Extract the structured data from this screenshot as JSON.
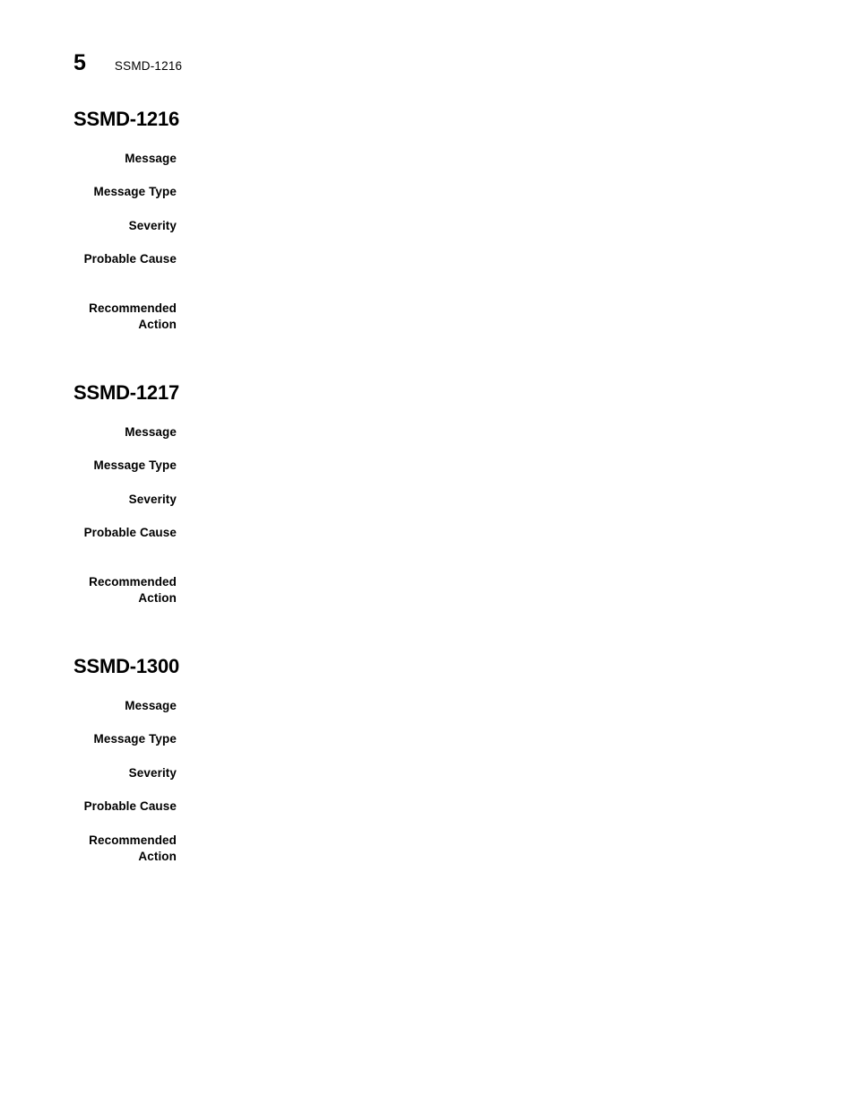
{
  "header": {
    "chapter_number": "5",
    "title": "SSMD-1216"
  },
  "labels": {
    "message": "Message",
    "message_type": "Message Type",
    "severity": "Severity",
    "probable_cause": "Probable Cause",
    "recommended_action": "Recommended\nAction"
  },
  "sections": [
    {
      "heading": "SSMD-1216",
      "fields": [
        {
          "label": "Message",
          "value": ""
        },
        {
          "label": "Message Type",
          "value": ""
        },
        {
          "label": "Severity",
          "value": ""
        },
        {
          "label": "Probable Cause",
          "value": ""
        },
        {
          "label": "Recommended\nAction",
          "value": ""
        }
      ]
    },
    {
      "heading": "SSMD-1217",
      "fields": [
        {
          "label": "Message",
          "value": ""
        },
        {
          "label": "Message Type",
          "value": ""
        },
        {
          "label": "Severity",
          "value": ""
        },
        {
          "label": "Probable Cause",
          "value": ""
        },
        {
          "label": "Recommended\nAction",
          "value": ""
        }
      ]
    },
    {
      "heading": "SSMD-1300",
      "fields": [
        {
          "label": "Message",
          "value": ""
        },
        {
          "label": "Message Type",
          "value": ""
        },
        {
          "label": "Severity",
          "value": ""
        },
        {
          "label": "Probable Cause",
          "value": ""
        },
        {
          "label": "Recommended\nAction",
          "value": ""
        }
      ]
    }
  ],
  "colors": {
    "text": "#000000",
    "background": "#ffffff"
  }
}
